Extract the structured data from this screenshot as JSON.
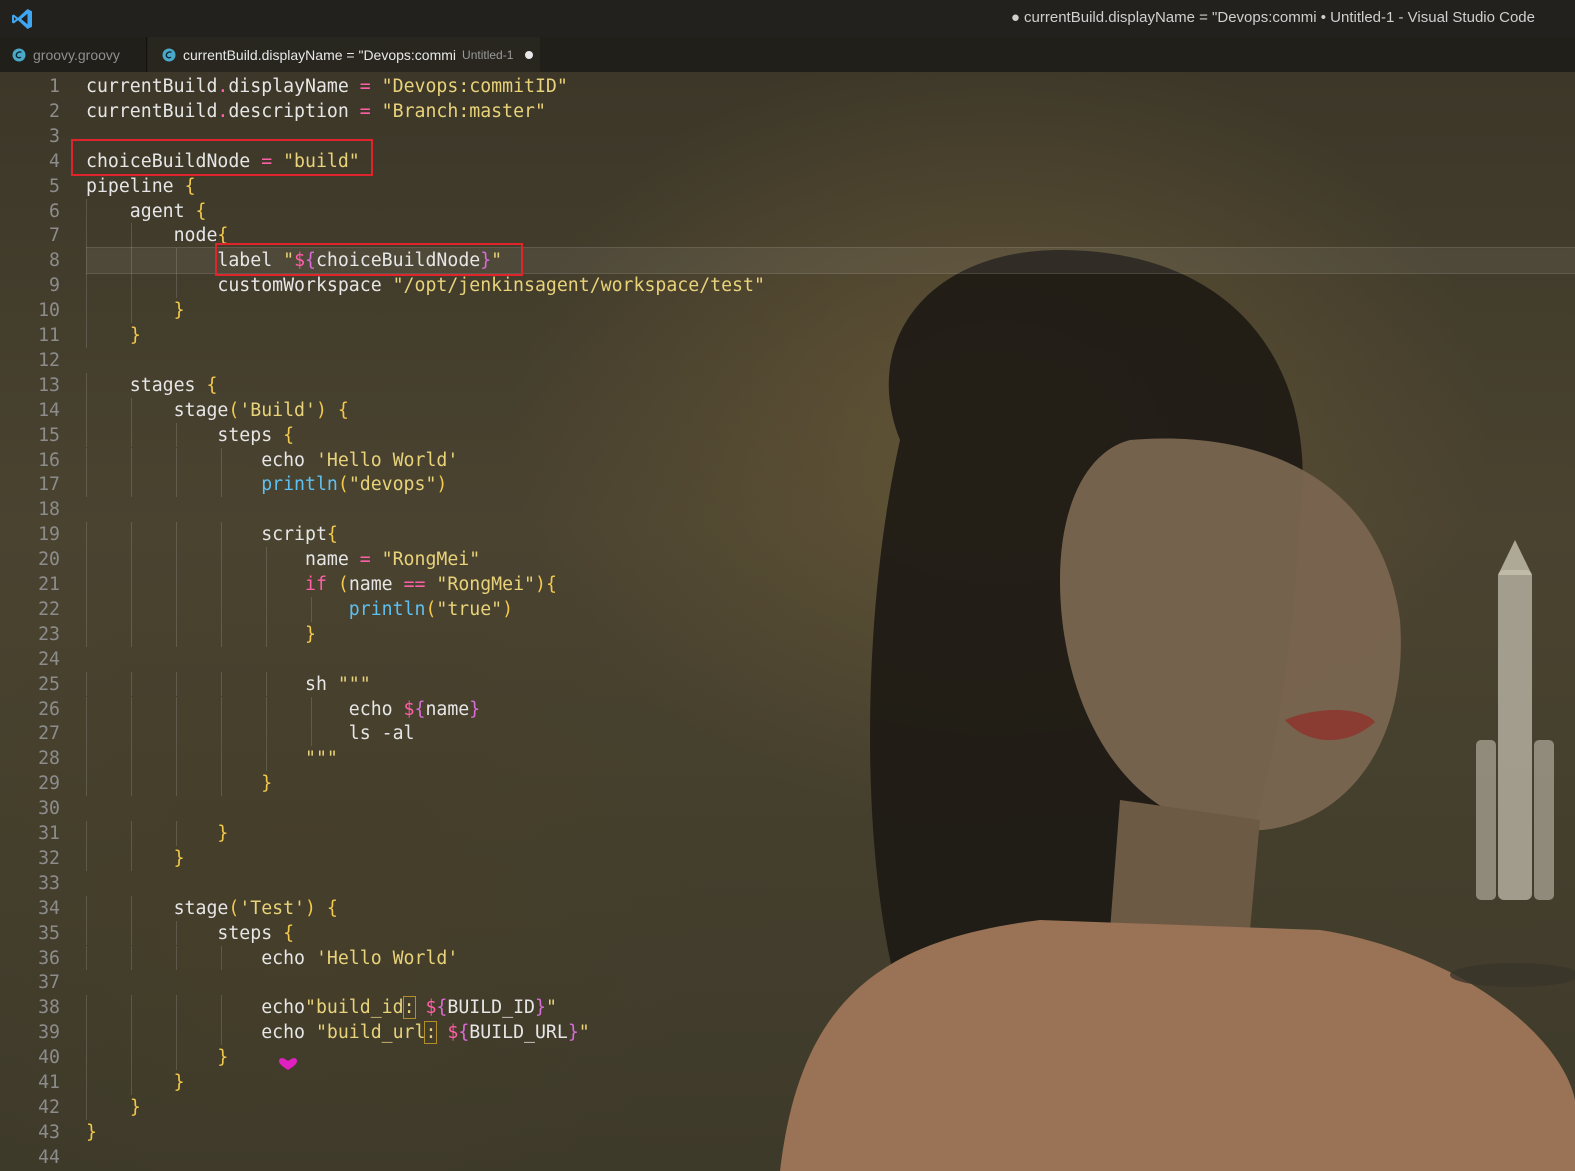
{
  "window": {
    "title": "● currentBuild.displayName = \"Devops:commi • Untitled-1 - Visual Studio Code"
  },
  "tabs": [
    {
      "label": "groovy.groovy",
      "icon": "groovy-file-icon",
      "active": false
    },
    {
      "label": "currentBuild.displayName = \"Devops:commi",
      "description": "Untitled-1",
      "icon": "groovy-file-icon",
      "active": true,
      "dirty": true
    }
  ],
  "editor": {
    "current_line": 8,
    "highlighted_lines": [
      4,
      8
    ],
    "lines": [
      "currentBuild.displayName = \"Devops:commitID\"",
      "currentBuild.description = \"Branch:master\"",
      "",
      "choiceBuildNode = \"build\"",
      "pipeline {",
      "    agent {",
      "        node{",
      "            label \"${choiceBuildNode}\"",
      "            customWorkspace \"/opt/jenkinsagent/workspace/test\"",
      "        }",
      "    }",
      "",
      "    stages {",
      "        stage('Build') {",
      "            steps {",
      "                echo 'Hello World'",
      "                println(\"devops\")",
      "",
      "                script{",
      "                    name = \"RongMei\"",
      "                    if (name == \"RongMei\"){",
      "                        println(\"true\")",
      "                    }",
      "",
      "                    sh \"\"\"",
      "                        echo ${name}",
      "                        ls -al",
      "                    \"\"\"",
      "                }",
      "",
      "            }",
      "        }",
      "",
      "        stage('Test') {",
      "            steps {",
      "                echo 'Hello World'",
      "",
      "                echo\"build_id: ${BUILD_ID}\"",
      "                echo \"build_url: ${BUILD_URL}\"",
      "            }",
      "        }",
      "    }",
      "}",
      ""
    ]
  },
  "colors": {
    "keyword": "#ff5fa8",
    "string": "#e8d27a",
    "function": "#5ec0f0",
    "annotation_box": "#e0242c"
  }
}
